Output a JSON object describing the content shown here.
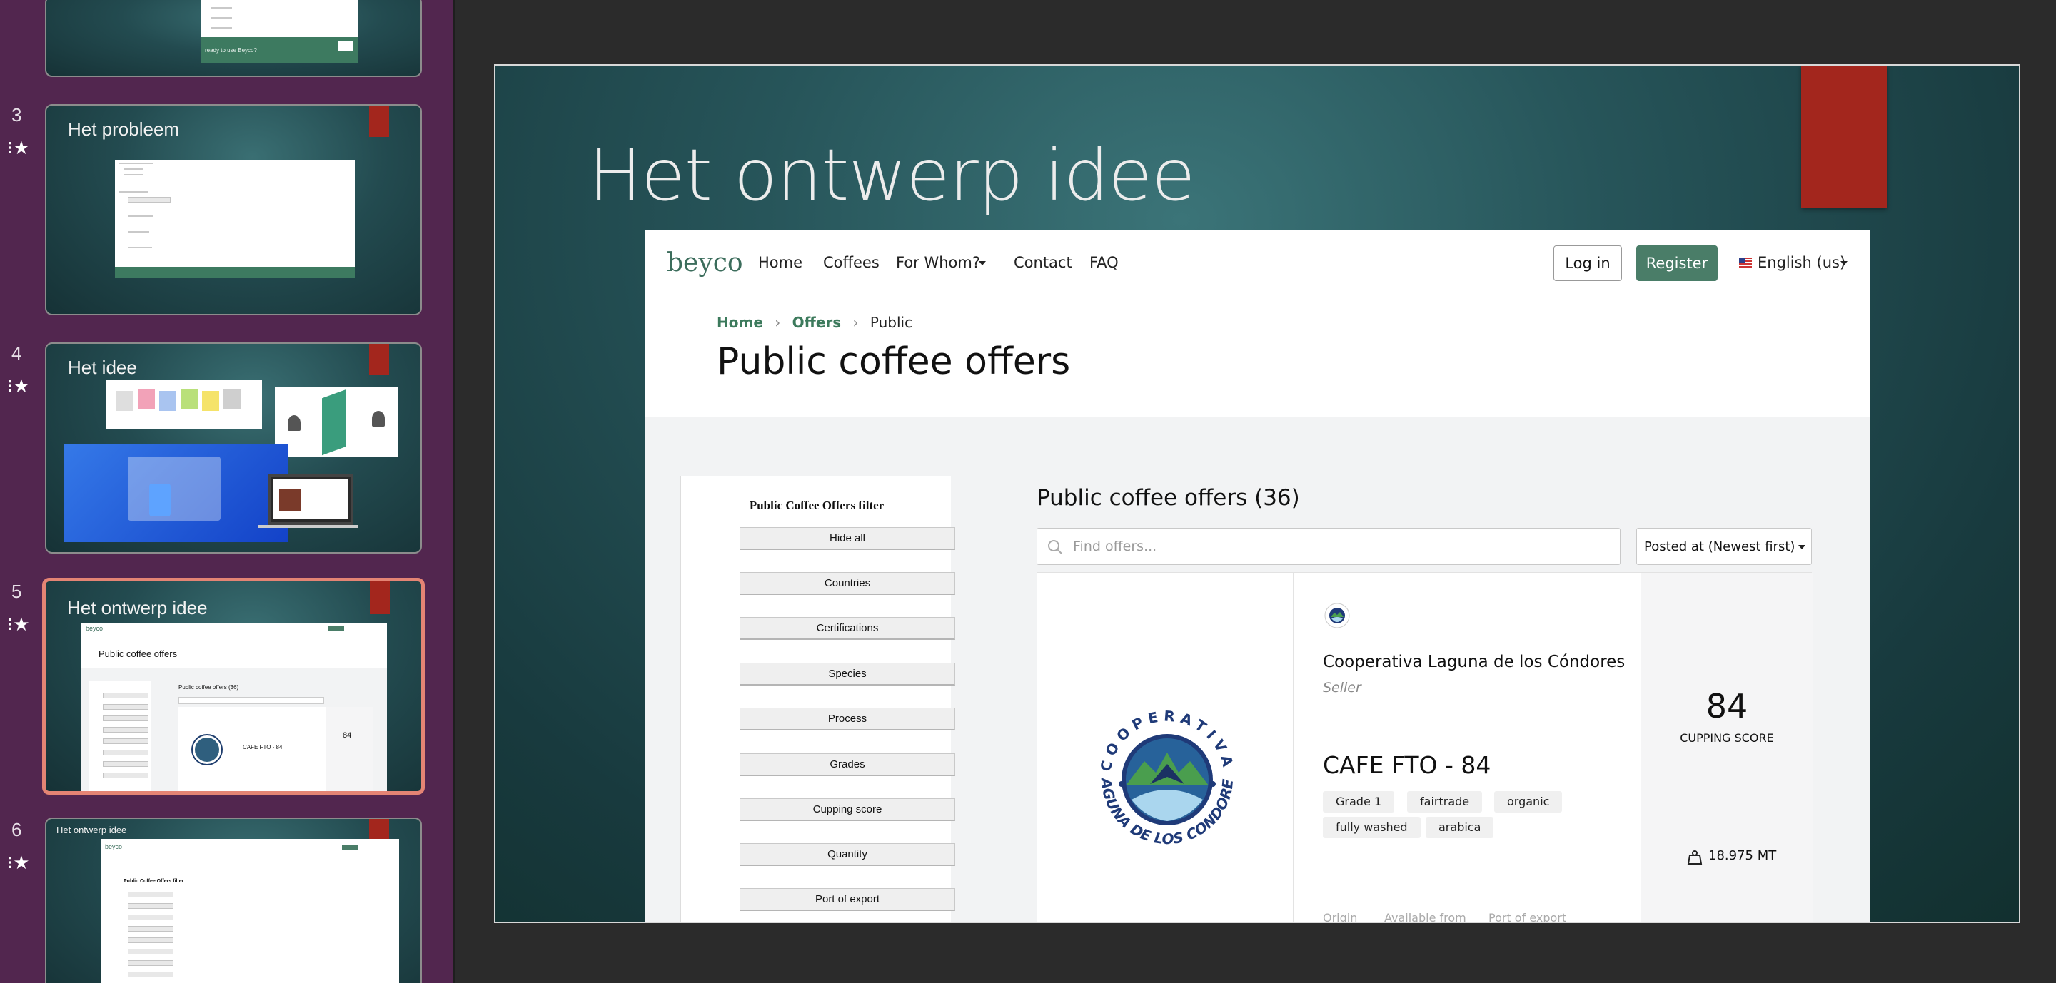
{
  "sidebar": {
    "slides": [
      {
        "number": "3",
        "title": "Het probleem"
      },
      {
        "number": "4",
        "title": "Het idee"
      },
      {
        "number": "5",
        "title": "Het ontwerp idee"
      },
      {
        "number": "6",
        "title": "Het ontwerp idee"
      }
    ],
    "top_partial_text": "ready to use Beyco?",
    "thumb5": {
      "heading": "Public coffee offers",
      "offers": "Public coffee offers (36)",
      "product": "CAFE FTO - 84",
      "score": "84"
    },
    "thumb6": {
      "filter_title": "Public Coffee Offers filter"
    }
  },
  "slide": {
    "title": "Het ontwerp idee",
    "accent_color": "#a3261d"
  },
  "website": {
    "logo": "beyco",
    "nav": {
      "home": "Home",
      "coffees": "Coffees",
      "for_whom": "For Whom?",
      "contact": "Contact",
      "faq": "FAQ"
    },
    "login": "Log in",
    "register": "Register",
    "language": "English (us)",
    "breadcrumb": {
      "home": "Home",
      "offers": "Offers",
      "current": "Public",
      "separator": "›"
    },
    "page_title": "Public coffee offers",
    "filter": {
      "title": "Public Coffee Offers filter",
      "buttons": [
        "Hide all",
        "Countries",
        "Certifications",
        "Species",
        "Process",
        "Grades",
        "Cupping score",
        "Quantity",
        "Port of export"
      ]
    },
    "offers_heading": "Public coffee offers (36)",
    "search_placeholder": "Find offers...",
    "sort_value": "Posted at (Newest first)",
    "card": {
      "seller_name": "Cooperativa Laguna de los Cóndores",
      "seller_role": "Seller",
      "logo_text_top": "COOPERATIVA",
      "logo_text_bottom": "LAGUNA DE LOS CONDORES",
      "product": "CAFE FTO - 84",
      "tags": [
        "Grade 1",
        "fairtrade",
        "organic",
        "fully washed",
        "arabica"
      ],
      "score": "84",
      "score_label": "CUPPING SCORE",
      "quantity": "18.975 MT",
      "meta": [
        "Origin",
        "Available from",
        "Port of export"
      ]
    },
    "brand_color": "#4a7d68"
  }
}
